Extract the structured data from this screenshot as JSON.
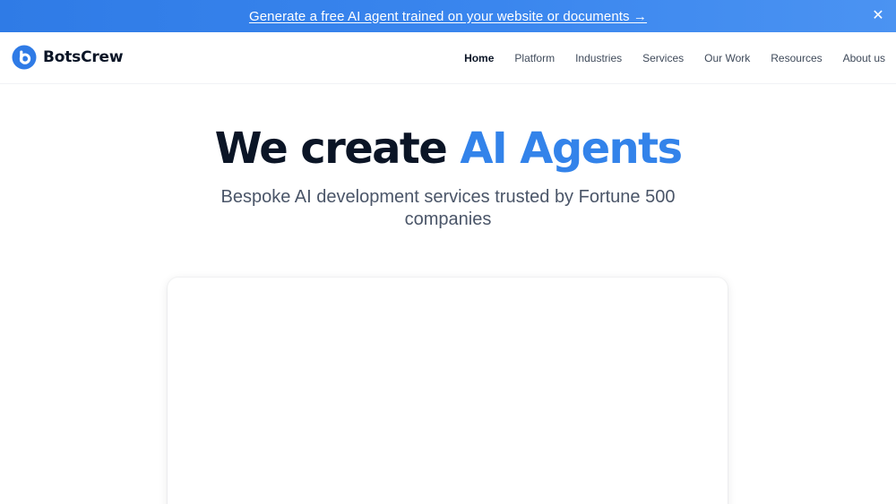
{
  "banner": {
    "text": "Generate a free AI agent trained on your website or documents →",
    "close_icon": "close-icon",
    "gradient": [
      "#2f7be6",
      "#4b93f2"
    ]
  },
  "header": {
    "brand": "BotsCrew",
    "logo_icon": "botscrew-logo-icon",
    "nav": [
      {
        "label": "Home",
        "active": true
      },
      {
        "label": "Platform",
        "active": false
      },
      {
        "label": "Industries",
        "active": false
      },
      {
        "label": "Services",
        "active": false
      },
      {
        "label": "Our Work",
        "active": false
      },
      {
        "label": "Resources",
        "active": false
      },
      {
        "label": "About us",
        "active": false
      }
    ]
  },
  "hero": {
    "title_prefix": "We create ",
    "title_accent": "AI Agents",
    "subtitle": "Bespoke AI development services trusted by Fortune 500 companies"
  },
  "colors": {
    "accent": "#3383ea",
    "heading": "#0b1526",
    "body_text": "#4a5568"
  }
}
